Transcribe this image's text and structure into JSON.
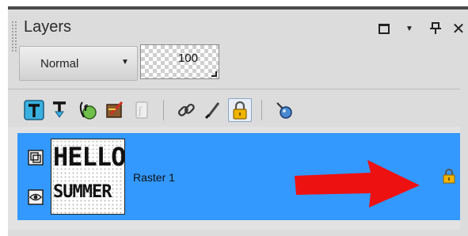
{
  "panel": {
    "title": "Layers",
    "controls": {
      "restore_icon": "window-restore-icon",
      "menu_icon": "dropdown-arrow-icon",
      "pin_icon": "pin-icon",
      "close_icon": "close-icon"
    }
  },
  "blend_mode": {
    "value": "Normal"
  },
  "opacity": {
    "value": "100"
  },
  "toolbar": {
    "icons": [
      "new-layer-icon",
      "merge-down-icon",
      "new-mask-icon",
      "layer-effects-icon",
      "layer-group-icon",
      "link-icon",
      "lock-transparency-icon",
      "visibility-toggle-icon"
    ]
  },
  "layers": [
    {
      "name": "Raster 1",
      "selected": true,
      "thumbnail_text": [
        "HELLO",
        "SUMMER"
      ],
      "locked": true
    }
  ],
  "colors": {
    "selection": "#3399ff",
    "panel_bg": "#dcdcdc",
    "annotation_arrow": "#ee1111",
    "lock": "#e0a800"
  }
}
